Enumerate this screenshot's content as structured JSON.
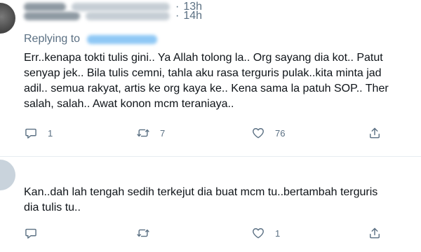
{
  "tweets": [
    {
      "time": "14h",
      "replying_label": "Replying to",
      "body_lines": [
        "Err..kenapa tokti tulis gini.. Ya Allah tolong la.. Org sayang dia kot.. Patut",
        "senyap jek.. Bila tulis cemni, tahla aku rasa terguris pulak..kita minta jad",
        "adil.. semua rakyat, artis ke org kaya ke.. Kena sama la patuh SOP.. Ther",
        "salah, salah.. Awat konon mcm teraniaya.."
      ],
      "actions": {
        "reply_count": "1",
        "retweet_count": "7",
        "like_count": "76"
      }
    },
    {
      "time": "13h",
      "body_lines": [
        "Kan..dah lah tengah sedih terkejut dia buat mcm tu..bertambah terguris",
        "dia tulis tu.."
      ],
      "actions": {
        "reply_count": "",
        "retweet_count": "",
        "like_count": "1"
      }
    }
  ],
  "icons": {
    "reply": "speech-bubble-icon",
    "retweet": "retweet-arrows-icon",
    "like": "heart-outline-icon",
    "share": "share-upload-icon"
  },
  "colors": {
    "muted_text": "#5b7083",
    "body_text": "#0f1419",
    "link_blue": "#1da1f2",
    "divider": "#e6ecf0"
  }
}
